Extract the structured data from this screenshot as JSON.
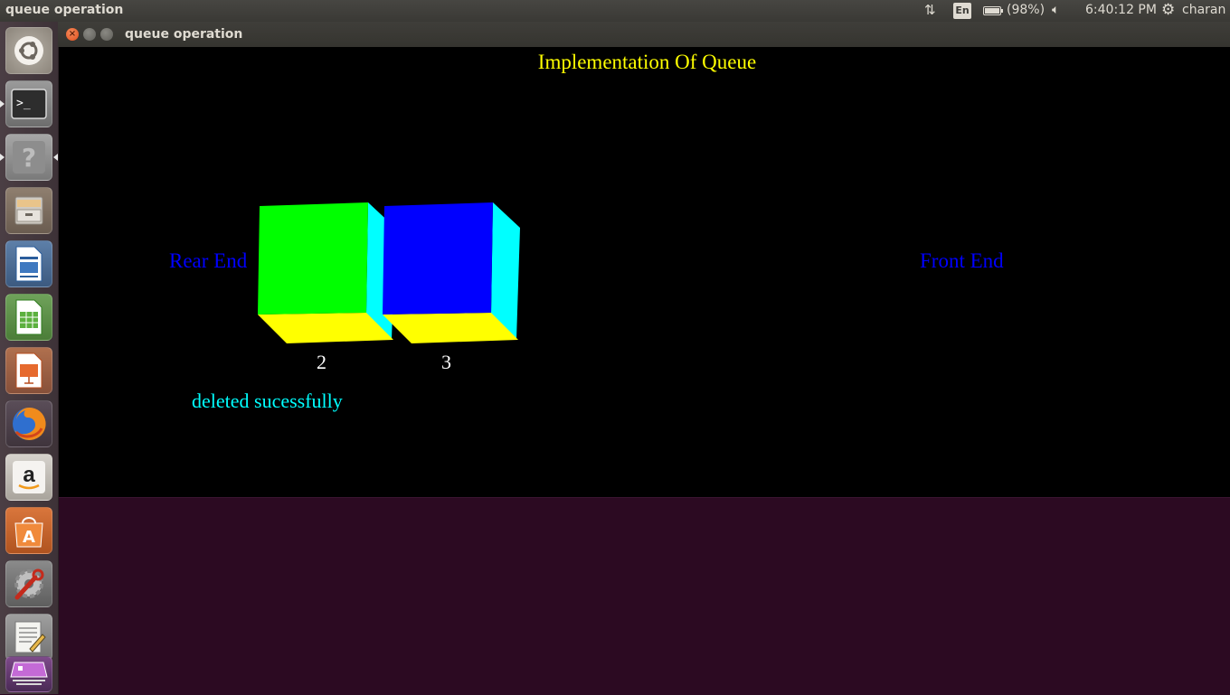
{
  "top_panel": {
    "app_title": "queue operation",
    "keyboard_layout": "En",
    "battery": "(98%)",
    "clock": "6:40:12 PM",
    "user": "charan"
  },
  "launcher": {
    "items": [
      {
        "name": "ubuntu-dash",
        "icon": "ubuntu-logo-icon"
      },
      {
        "name": "terminal",
        "icon": "terminal-icon"
      },
      {
        "name": "help",
        "icon": "question-icon"
      },
      {
        "name": "files",
        "icon": "file-cabinet-icon"
      },
      {
        "name": "libreoffice-writer",
        "icon": "writer-icon"
      },
      {
        "name": "libreoffice-calc",
        "icon": "calc-icon"
      },
      {
        "name": "libreoffice-impress",
        "icon": "impress-icon"
      },
      {
        "name": "firefox",
        "icon": "firefox-icon"
      },
      {
        "name": "amazon",
        "icon": "amazon-icon"
      },
      {
        "name": "software-center",
        "icon": "software-center-icon"
      },
      {
        "name": "system-settings",
        "icon": "settings-icon"
      },
      {
        "name": "text-editor",
        "icon": "text-editor-icon"
      },
      {
        "name": "workspace-switcher",
        "icon": "workspace-icon"
      }
    ]
  },
  "window": {
    "title": "queue operation",
    "close_glyph": "×"
  },
  "canvas": {
    "heading": "Implementation Of Queue",
    "rear_label": "Rear End",
    "front_label": "Front End",
    "status_message": "deleted sucessfully",
    "queue": [
      {
        "value": "2",
        "face_color": "#00ff00"
      },
      {
        "value": "3",
        "face_color": "#0000ff"
      }
    ],
    "colors": {
      "heading": "#ffff00",
      "end_labels": "#0000ff",
      "values": "#ffffff",
      "status": "#00ffff",
      "cube_side": "#00ffff",
      "cube_bottom": "#ffff00"
    }
  }
}
